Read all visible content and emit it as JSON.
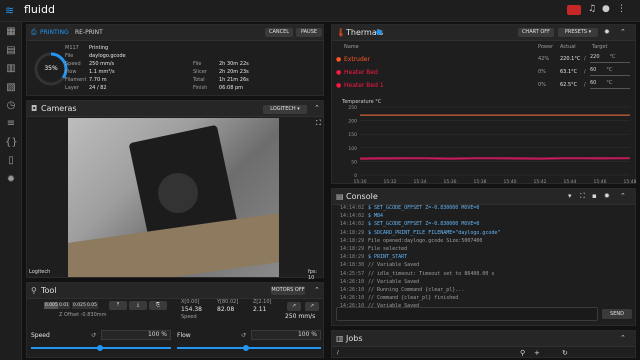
{
  "app": {
    "title": "fluidd",
    "accent": "#2196f3"
  },
  "sidebar": {
    "icons": [
      "dashboard-icon",
      "console-icon",
      "file-icon",
      "jobs-icon",
      "history-icon",
      "tune-icon",
      "macros-icon",
      "config-icon",
      "settings-icon"
    ]
  },
  "status": {
    "tab_printing": "PRINTING",
    "tab_reprint": "RE-PRINT",
    "cancel_label": "CANCEL",
    "pause_label": "PAUSE",
    "progress": "35%",
    "progress_value": 0.35,
    "rows": [
      {
        "k": "M117",
        "v": "Printing"
      },
      {
        "k": "File",
        "v": "daylogo.gcode"
      },
      {
        "k": "Speed",
        "v": "250 mm/s"
      },
      {
        "k": "Flow",
        "v": "1.1 mm³/s"
      },
      {
        "k": "Filament",
        "v": "7.70 m"
      },
      {
        "k": "Layer",
        "v": "24 / 82"
      }
    ],
    "rows2": [
      {
        "k": "File",
        "v": "2h 30m 22s"
      },
      {
        "k": "Slicer",
        "v": "2h 20m 23s"
      },
      {
        "k": "Total",
        "v": "1h 21m 26s"
      },
      {
        "k": "Finish",
        "v": "06:08 pm"
      }
    ]
  },
  "cameras": {
    "title": "Cameras",
    "selector": "LOGITECH",
    "name": "Logitech",
    "fps": "fps: 10"
  },
  "tool": {
    "title": "Tool",
    "motors": "MOTORS OFF",
    "steps": [
      "0.005",
      "0.01",
      "0.025",
      "0.05"
    ],
    "zoffset": "Z Offset -0.830mm",
    "x_label": "X[0.00]",
    "x_val": "154.38",
    "y_label": "Y[80.02]",
    "y_val": "82.08",
    "z_label": "Z[2.10]",
    "z_val": "2.11",
    "speed_label": "Speed",
    "speed_val": "250 mm/s",
    "speed_pct_label": "Speed",
    "speed_pct": "100 %",
    "flow_label": "Flow",
    "flow_pct": "100 %"
  },
  "thermals": {
    "title": "Thermals",
    "chart_off": "CHART OFF",
    "presets": "PRESETS",
    "headers": {
      "name": "Name",
      "power": "Power",
      "actual": "Actual",
      "target": "Target"
    },
    "rows": [
      {
        "name": "Extruder",
        "power": "42%",
        "actual": "220.1°C",
        "target": "220",
        "unit": "°C",
        "color": "#ff5722"
      },
      {
        "name": "Heater Bed",
        "power": "0%",
        "actual": "63.1°C",
        "target": "60",
        "unit": "°C",
        "color": "#ff1744"
      },
      {
        "name": "Heater Bed 1",
        "power": "0%",
        "actual": "62.5°C",
        "target": "60",
        "unit": "°C",
        "color": "#ff1744"
      }
    ]
  },
  "chart_data": {
    "type": "line",
    "ylabel": "Temperature °C",
    "ylim": [
      0,
      250
    ],
    "yticks": [
      "250",
      "200",
      "150",
      "100",
      "50",
      "0"
    ],
    "x": [
      "15:30",
      "15:32",
      "15:34",
      "15:36",
      "15:38",
      "15:40",
      "15:42",
      "15:44",
      "15:46",
      "15:48"
    ],
    "series": [
      {
        "values": [
          220,
          220,
          220,
          220,
          220,
          220,
          220,
          220,
          220,
          220
        ],
        "color": "#ff7043"
      },
      {
        "values": [
          62,
          63,
          63,
          62,
          63,
          63,
          62,
          63,
          63,
          63
        ],
        "color": "#e91e63"
      },
      {
        "values": [
          58,
          59,
          60,
          58,
          60,
          59,
          58,
          60,
          59,
          60
        ],
        "color": "#c2185b"
      }
    ],
    "grid": true
  },
  "console": {
    "title": "Console",
    "lines": [
      {
        "t": "14:14:02",
        "m": "$ SET_GCODE_OFFSET Z=-0.830000 MOVE=0",
        "c": "#64b5f6"
      },
      {
        "t": "14:14:02",
        "m": "$ M84",
        "c": "#64b5f6"
      },
      {
        "t": "14:14:02",
        "m": "$ SET_GCODE_OFFSET Z=-0.830000 MOVE=0",
        "c": "#64b5f6"
      },
      {
        "t": "14:18:29",
        "m": "$ SDCARD_PRINT_FILE FILENAME=\"daylogo.gcode\"",
        "c": "#64b5f6"
      },
      {
        "t": "14:18:29",
        "m": "File opened:daylogo.gcode Size:5007400",
        "c": "#9e9e9e"
      },
      {
        "t": "14:18:29",
        "m": "File selected",
        "c": "#9e9e9e"
      },
      {
        "t": "14:18:29",
        "m": "$ PRINT_START",
        "c": "#64b5f6"
      },
      {
        "t": "14:18:30",
        "m": "// Variable Saved",
        "c": "#9e9e9e"
      },
      {
        "t": "14:25:57",
        "m": "// idle_timeout: Timeout set to 86400.00 s",
        "c": "#9e9e9e"
      },
      {
        "t": "14:26:10",
        "m": "// Variable Saved",
        "c": "#9e9e9e"
      },
      {
        "t": "14:26:10",
        "m": "// Running Command {clear_pl}...",
        "c": "#9e9e9e"
      },
      {
        "t": "14:26:10",
        "m": "// Command {clear_pl} finished",
        "c": "#9e9e9e"
      },
      {
        "t": "14:26:10",
        "m": "// Variable Saved",
        "c": "#9e9e9e"
      }
    ],
    "send": "SEND"
  },
  "jobs": {
    "title": "Jobs",
    "path": "/"
  }
}
